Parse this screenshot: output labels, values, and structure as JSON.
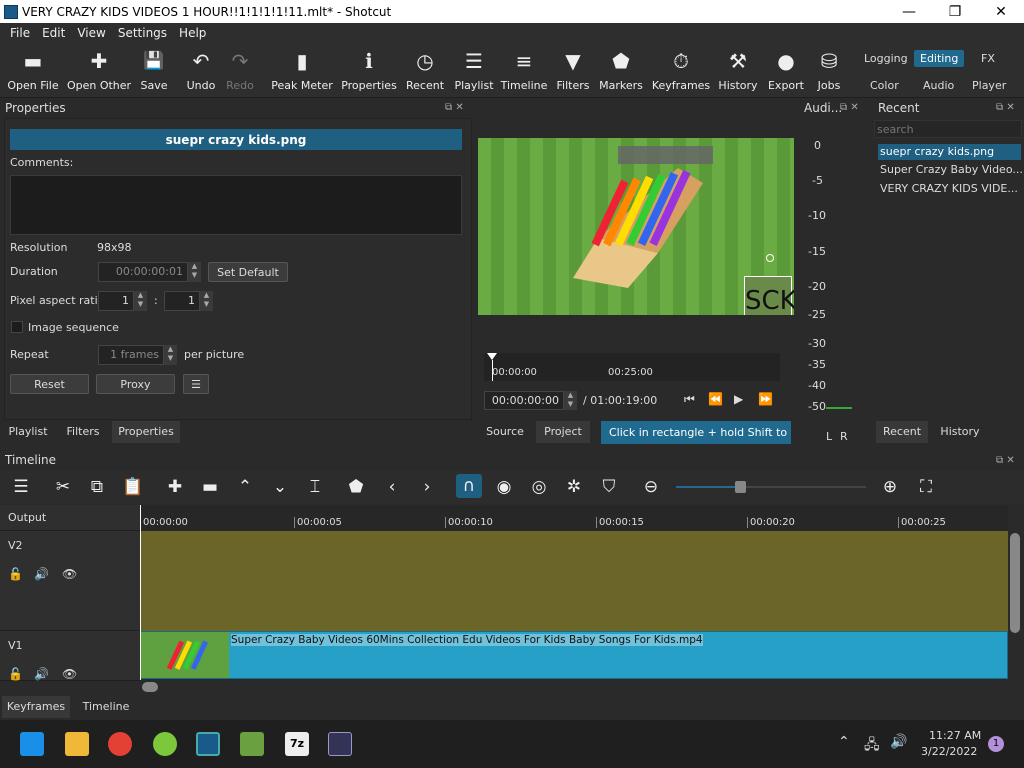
{
  "window": {
    "title": "VERY CRAZY KIDS VIDEOS 1 HOUR!!1!1!1!1!11.mlt* - Shotcut",
    "minimize": "—",
    "maximize": "❐",
    "close": "✕"
  },
  "menu": [
    "File",
    "Edit",
    "View",
    "Settings",
    "Help"
  ],
  "toolbar": [
    {
      "label": "Open File",
      "icon": "▬"
    },
    {
      "label": "Open Other",
      "icon": "✚"
    },
    {
      "label": "Save",
      "icon": "💾"
    },
    {
      "label": "Undo",
      "icon": "↶"
    },
    {
      "label": "Redo",
      "icon": "↷"
    },
    {
      "label": "Peak Meter",
      "icon": "▮"
    },
    {
      "label": "Properties",
      "icon": "ℹ"
    },
    {
      "label": "Recent",
      "icon": "◷"
    },
    {
      "label": "Playlist",
      "icon": "☰"
    },
    {
      "label": "Timeline",
      "icon": "≡"
    },
    {
      "label": "Filters",
      "icon": "▼"
    },
    {
      "label": "Markers",
      "icon": "⬟"
    },
    {
      "label": "Keyframes",
      "icon": "⏱"
    },
    {
      "label": "History",
      "icon": "⚒"
    },
    {
      "label": "Export",
      "icon": "●"
    },
    {
      "label": "Jobs",
      "icon": "⛁"
    }
  ],
  "layouts": {
    "row1": [
      "Logging",
      "Editing",
      "FX"
    ],
    "row2": [
      "Color",
      "Audio",
      "Player"
    ],
    "active": "Editing"
  },
  "properties": {
    "title": "Properties",
    "filename": "suepr crazy kids.png",
    "comments_label": "Comments:",
    "resolution_label": "Resolution",
    "resolution": "98x98",
    "duration_label": "Duration",
    "duration": "00:00:00:01",
    "set_default": "Set Default",
    "par_label": "Pixel aspect ratio",
    "par_num": "1",
    "par_den": "1",
    "par_sep": ":",
    "image_seq": "Image sequence",
    "repeat_label": "Repeat",
    "repeat_value": "1 frames",
    "per_picture": "per picture",
    "reset": "Reset",
    "proxy": "Proxy",
    "menu": "☰"
  },
  "left_tabs": [
    "Playlist",
    "Filters",
    "Properties"
  ],
  "player": {
    "overlay_text": "SCK",
    "ruler_ticks": [
      "00:00:00",
      "00:25:00"
    ],
    "timecode": "00:00:00:00",
    "total": "/ 01:00:19:00",
    "tabs": [
      "Source",
      "Project"
    ],
    "hint": "Click in rectangle + hold Shift to d..."
  },
  "audio": {
    "title": "Audi...",
    "scale": [
      "0",
      "-5",
      "-10",
      "-15",
      "-20",
      "-25",
      "-30",
      "-35",
      "-40",
      "-50"
    ],
    "channels": [
      "L",
      "R"
    ]
  },
  "recent": {
    "title": "Recent",
    "search_placeholder": "search",
    "items": [
      "suepr crazy kids.png",
      "Super Crazy Baby Video...",
      "VERY CRAZY KIDS VIDE..."
    ],
    "tabs": [
      "Recent",
      "History"
    ]
  },
  "timeline": {
    "title": "Timeline",
    "output": "Output",
    "ticks": [
      "00:00:00",
      "00:00:05",
      "00:00:10",
      "00:00:15",
      "00:00:20",
      "00:00:25"
    ],
    "tracks": [
      "V2",
      "V1"
    ],
    "clip": "Super Crazy Baby Videos 60Mins Collection   Edu Videos For Kids Baby Songs For Kids.mp4",
    "bottom_tabs": [
      "Keyframes",
      "Timeline"
    ]
  },
  "taskbar": {
    "time": "11:27 AM",
    "date": "3/22/2022",
    "badge": "1"
  }
}
